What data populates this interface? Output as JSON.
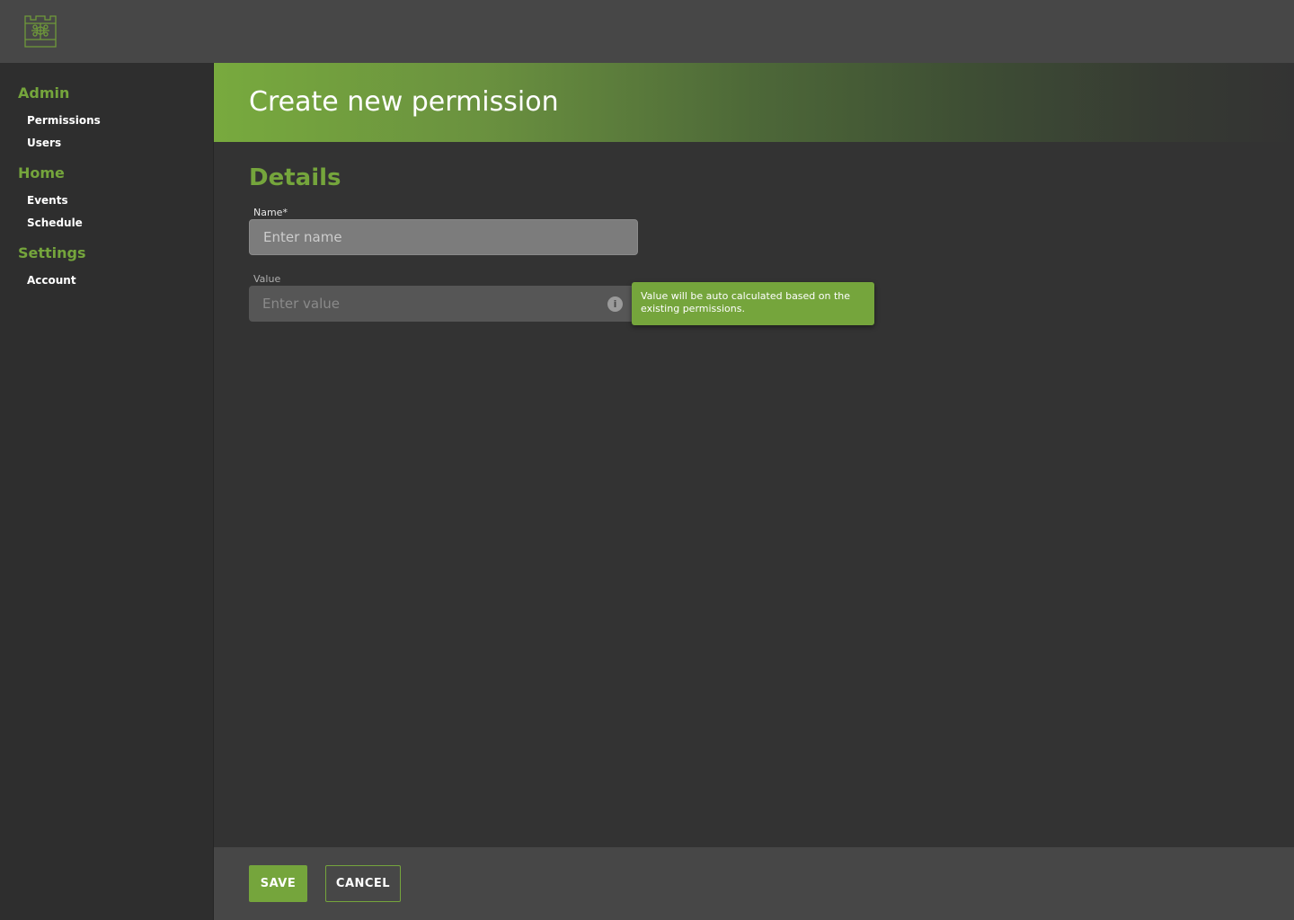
{
  "sidebar": {
    "groups": [
      {
        "title": "Admin",
        "items": [
          "Permissions",
          "Users"
        ]
      },
      {
        "title": "Home",
        "items": [
          "Events",
          "Schedule"
        ]
      },
      {
        "title": "Settings",
        "items": [
          "Account"
        ]
      }
    ]
  },
  "page": {
    "title": "Create new permission",
    "section_title": "Details"
  },
  "form": {
    "name": {
      "label": "Name*",
      "placeholder": "Enter name",
      "value": ""
    },
    "value": {
      "label": "Value",
      "placeholder": "Enter value",
      "value": ""
    },
    "tooltip": "Value will be auto calculated based on the existing permissions."
  },
  "footer": {
    "save_label": "SAVE",
    "cancel_label": "CANCEL"
  },
  "icons": {
    "logo": "castle-logo-icon",
    "info": "info-icon"
  },
  "colors": {
    "accent": "#75a53c",
    "background": "#333333",
    "topbar": "#474747",
    "sidebar": "#2e2e2e"
  }
}
